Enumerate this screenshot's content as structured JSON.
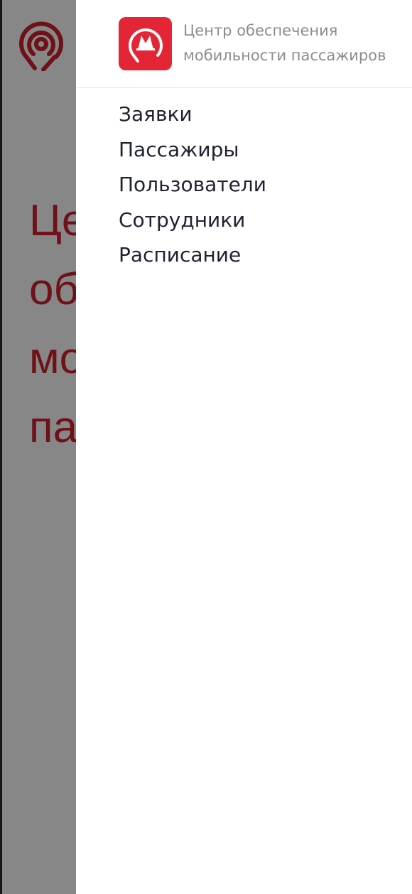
{
  "background": {
    "title_lines": [
      "Центр",
      "обеспечения",
      "мобильности",
      "пассажиров"
    ]
  },
  "drawer": {
    "header_title_line1": "Центр обеспечения",
    "header_title_line2": "мобильности пассажиров",
    "menu": [
      {
        "label": "Заявки"
      },
      {
        "label": "Пассажиры"
      },
      {
        "label": "Пользователи"
      },
      {
        "label": "Сотрудники"
      },
      {
        "label": "Расписание"
      }
    ]
  },
  "colors": {
    "brand_red": "#e42535",
    "overlay": "rgba(0,0,0,0.47)",
    "menu_text": "#1f2230",
    "header_text": "#8c8c8c"
  },
  "icons": {
    "background_logo": "mobility-pin-logo-icon",
    "app_logo": "metro-pin-logo-icon"
  }
}
